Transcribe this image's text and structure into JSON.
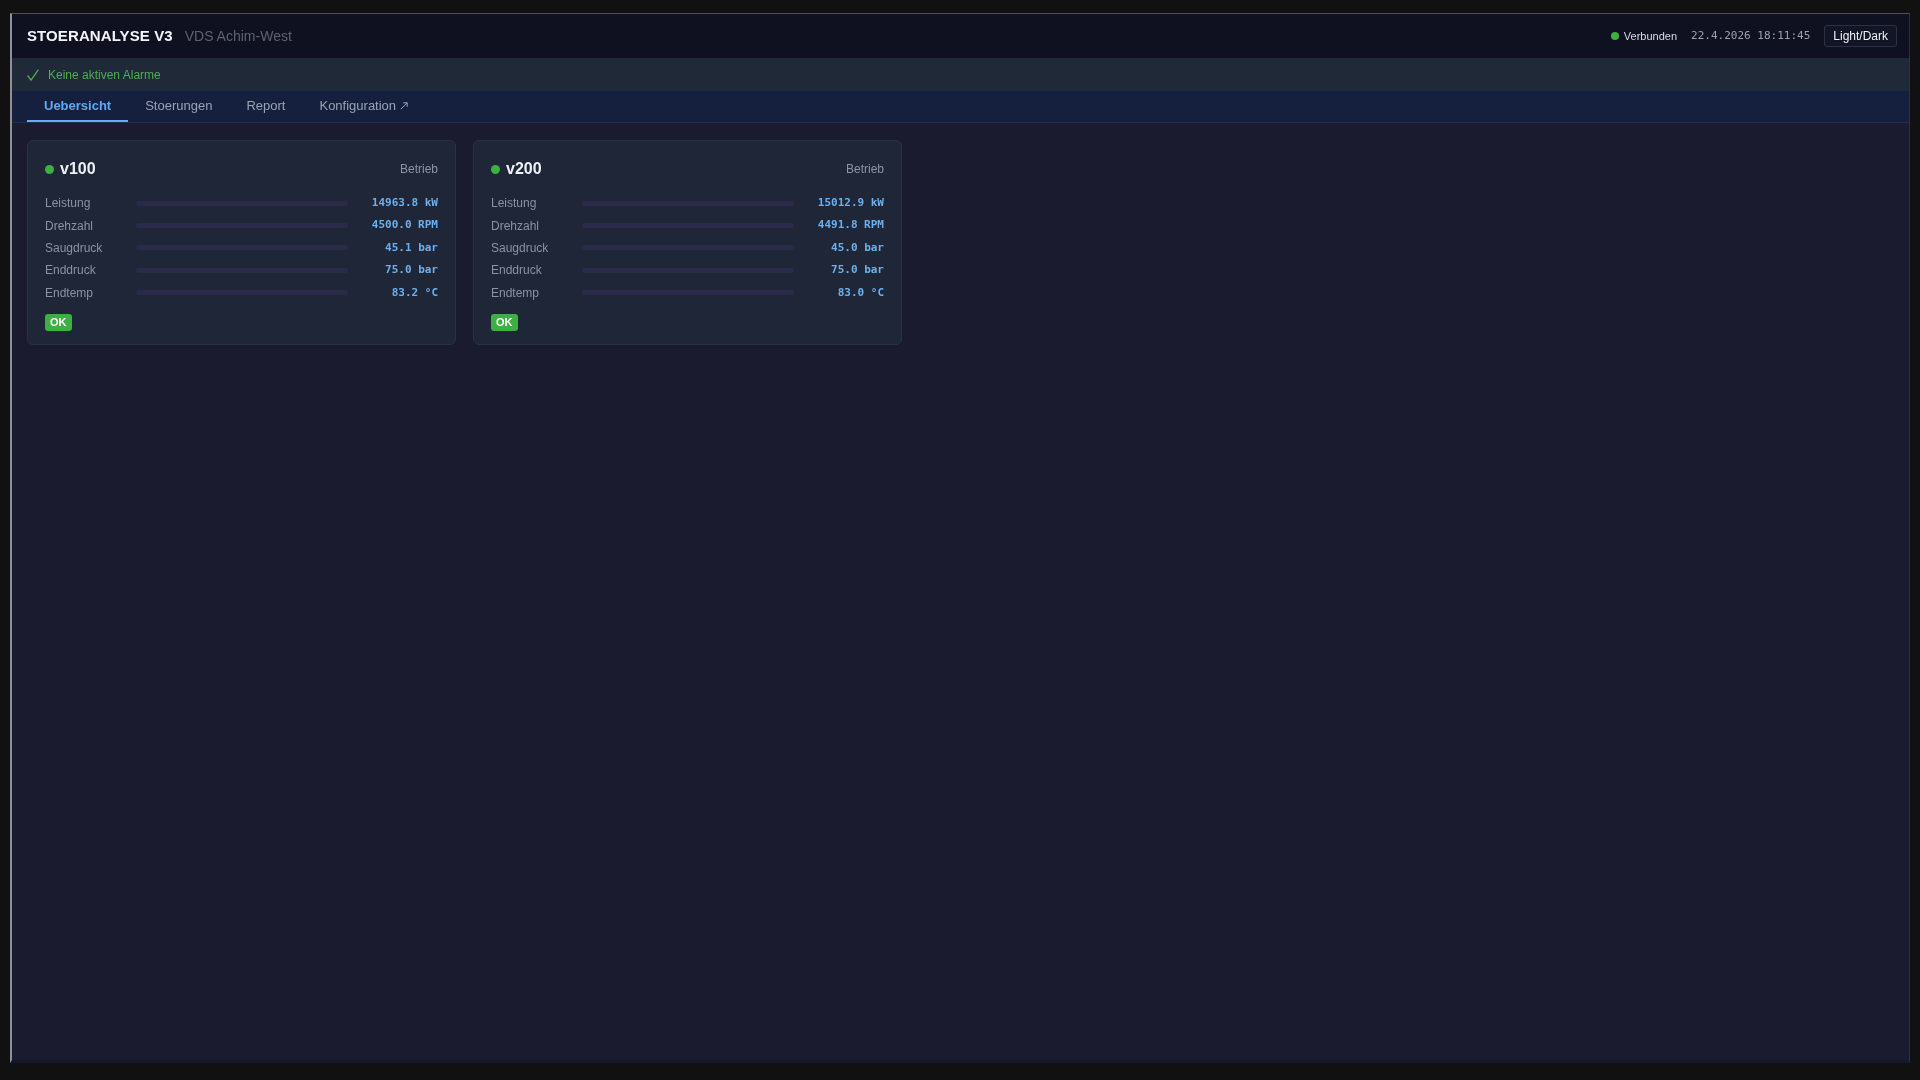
{
  "header": {
    "title": "STOERANALYSE V3",
    "subtitle": "VDS Achim-West",
    "connection": {
      "label": "Verbunden",
      "connected": true
    },
    "datetime": "22.4.2026 18:11:45",
    "theme_button": "Light/Dark"
  },
  "alarm_bar": {
    "has_alarms": false,
    "message": "Keine aktiven Alarme"
  },
  "tabs": [
    {
      "label": "Uebersicht",
      "selected": true,
      "external": false
    },
    {
      "label": "Stoerungen",
      "selected": false,
      "external": false
    },
    {
      "label": "Report",
      "selected": false,
      "external": false
    },
    {
      "label": "Konfiguration",
      "selected": false,
      "external": true
    }
  ],
  "units": [
    {
      "name": "v100",
      "color": "#3cb043",
      "state": "Betrieb",
      "metrics": [
        {
          "label": "Leistung",
          "reading": "14963.8 kW"
        },
        {
          "label": "Drehzahl",
          "reading": "4500.0 RPM"
        },
        {
          "label": "Saugdruck",
          "reading": "45.1 bar"
        },
        {
          "label": "Enddruck",
          "reading": "75.0 bar"
        },
        {
          "label": "Endtemp",
          "reading": "83.2 °C"
        }
      ],
      "badge": {
        "label": "OK",
        "ok": true
      }
    },
    {
      "name": "v200",
      "color": "#3cb043",
      "state": "Betrieb",
      "metrics": [
        {
          "label": "Leistung",
          "reading": "15012.9 kW"
        },
        {
          "label": "Drehzahl",
          "reading": "4491.8 RPM"
        },
        {
          "label": "Saugdruck",
          "reading": "45.0 bar"
        },
        {
          "label": "Enddruck",
          "reading": "75.0 bar"
        },
        {
          "label": "Endtemp",
          "reading": "83.0 °C"
        }
      ],
      "badge": {
        "label": "OK",
        "ok": true
      }
    }
  ]
}
